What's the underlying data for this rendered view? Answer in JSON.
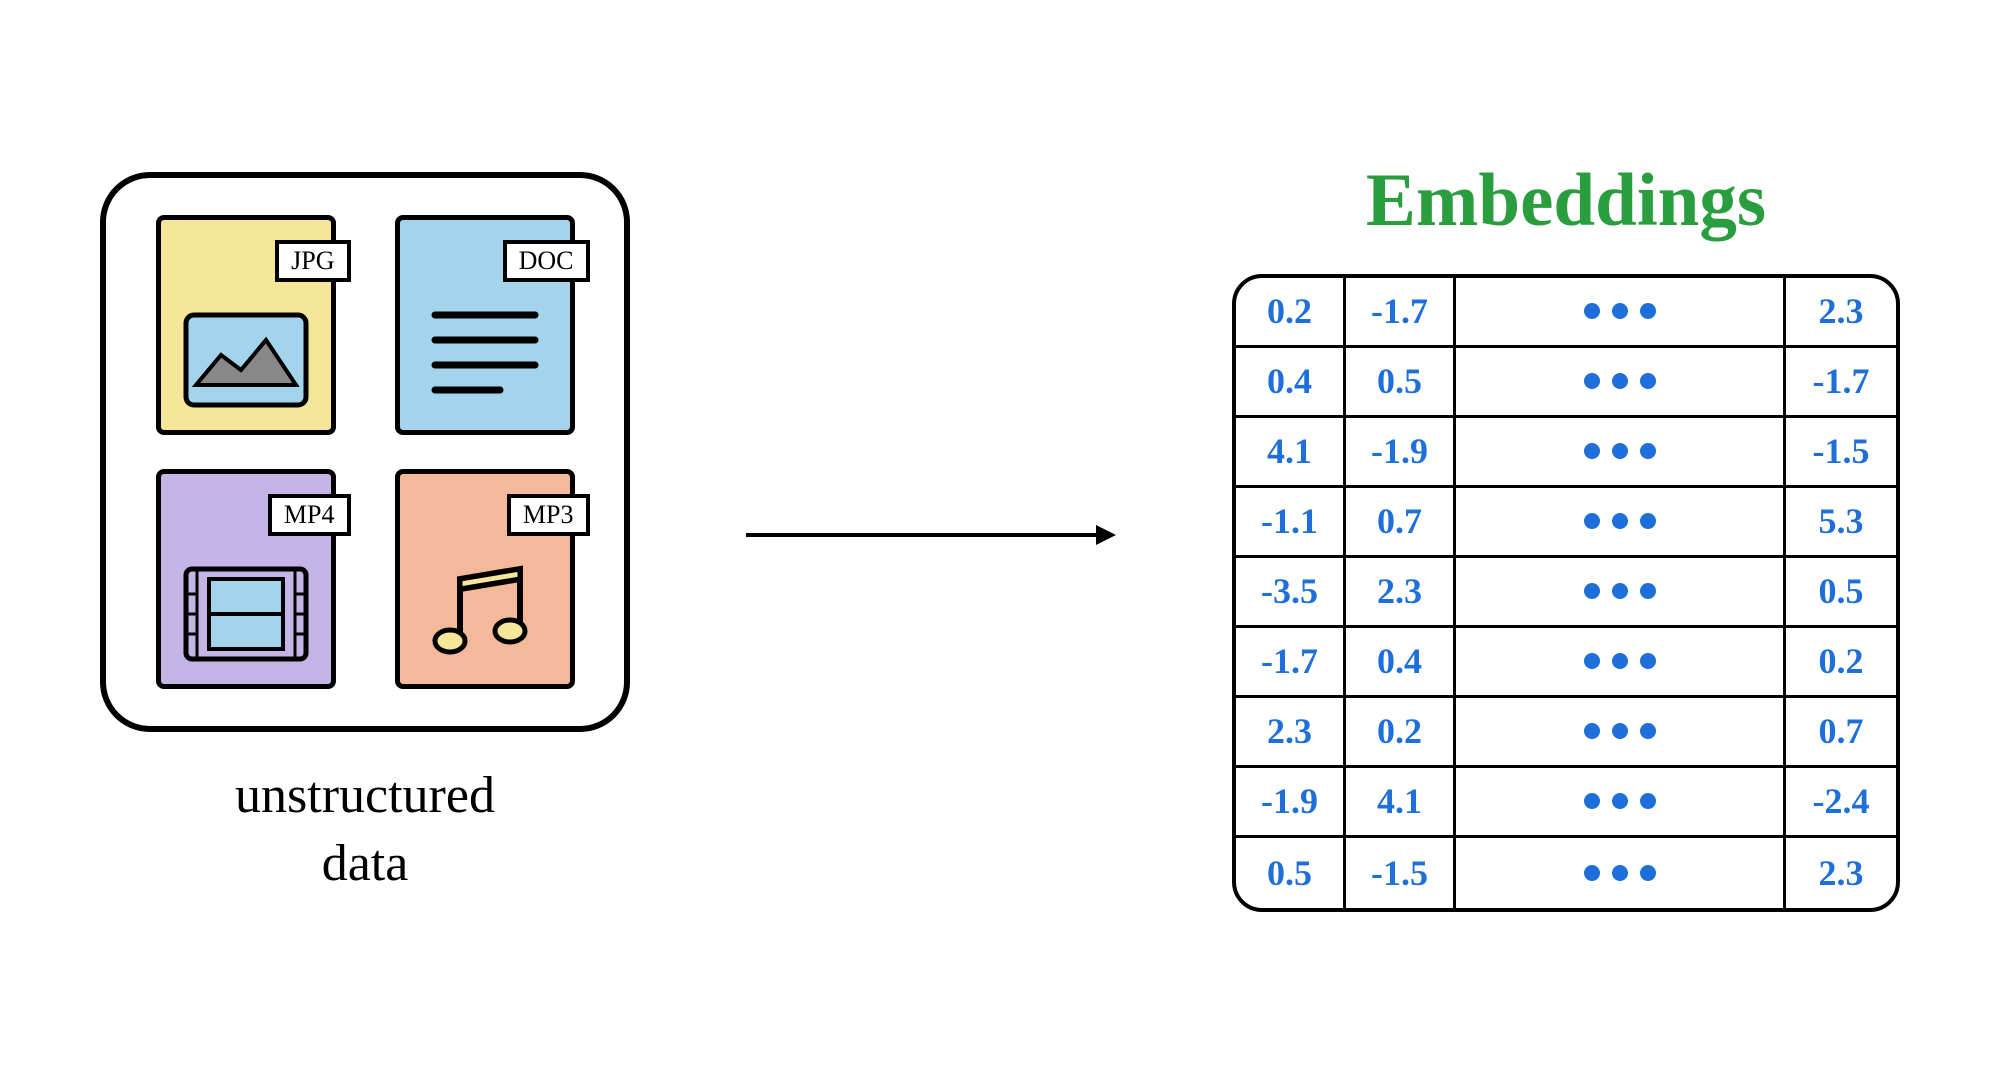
{
  "left": {
    "files": [
      {
        "label": "JPG",
        "type": "image"
      },
      {
        "label": "DOC",
        "type": "document"
      },
      {
        "label": "MP4",
        "type": "video"
      },
      {
        "label": "MP3",
        "type": "audio"
      }
    ],
    "caption_line1": "unstructured",
    "caption_line2": "data"
  },
  "right": {
    "title": "Embeddings",
    "rows": [
      {
        "c1": "0.2",
        "c2": "-1.7",
        "c4": "2.3"
      },
      {
        "c1": "0.4",
        "c2": "0.5",
        "c4": "-1.7"
      },
      {
        "c1": "4.1",
        "c2": "-1.9",
        "c4": "-1.5"
      },
      {
        "c1": "-1.1",
        "c2": "0.7",
        "c4": "5.3"
      },
      {
        "c1": "-3.5",
        "c2": "2.3",
        "c4": "0.5"
      },
      {
        "c1": "-1.7",
        "c2": "0.4",
        "c4": "0.2"
      },
      {
        "c1": "2.3",
        "c2": "0.2",
        "c4": "0.7"
      },
      {
        "c1": "-1.9",
        "c2": "4.1",
        "c4": "-2.4"
      },
      {
        "c1": "0.5",
        "c2": "-1.5",
        "c4": "2.3"
      }
    ]
  }
}
